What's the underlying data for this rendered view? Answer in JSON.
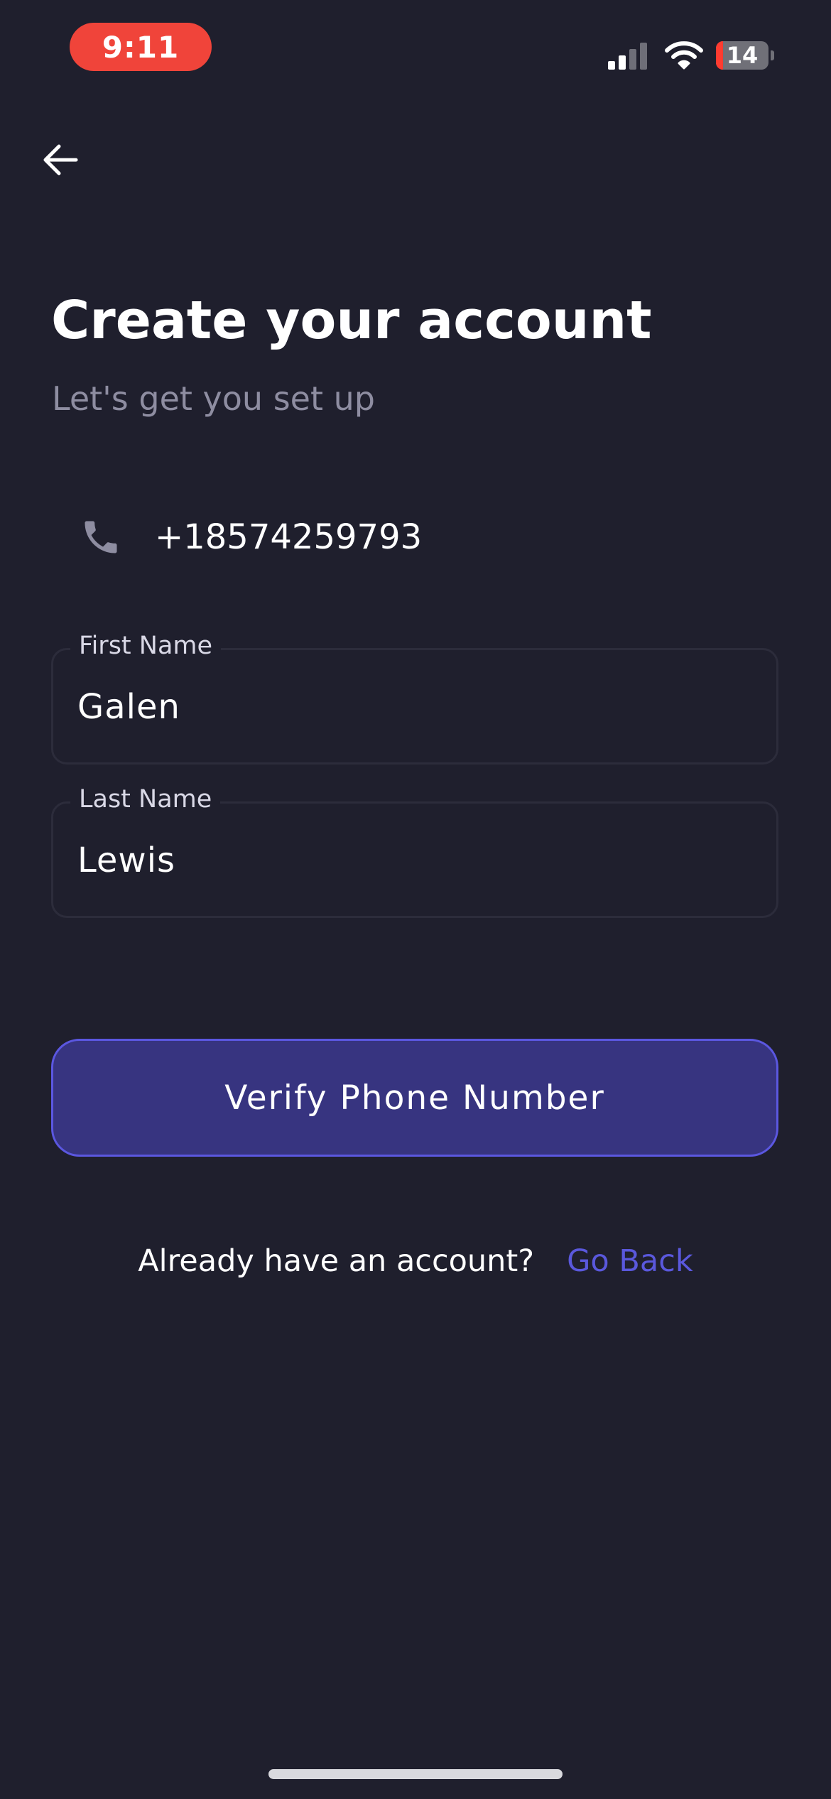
{
  "status_bar": {
    "time": "9:11",
    "battery_level": "14",
    "battery_fraction": 0.14,
    "time_pill_color": "#f0443a",
    "icons": [
      "cellular-signal-icon",
      "wifi-icon",
      "battery-icon"
    ]
  },
  "nav": {
    "back_icon": "arrow-left-icon"
  },
  "header": {
    "title": "Create your account",
    "subtitle": "Let's get you set up"
  },
  "phone": {
    "icon": "phone-icon",
    "number": "+18574259793"
  },
  "form": {
    "first_name": {
      "label": "First Name",
      "value": "Galen"
    },
    "last_name": {
      "label": "Last Name",
      "value": "Lewis"
    }
  },
  "actions": {
    "verify_label": "Verify Phone Number",
    "account_prompt": "Already have an account?",
    "go_back_label": "Go Back"
  },
  "colors": {
    "background": "#1f1f2d",
    "accent": "#5a58dc",
    "button_fill": "#373480",
    "muted_text": "#8e8da1"
  }
}
